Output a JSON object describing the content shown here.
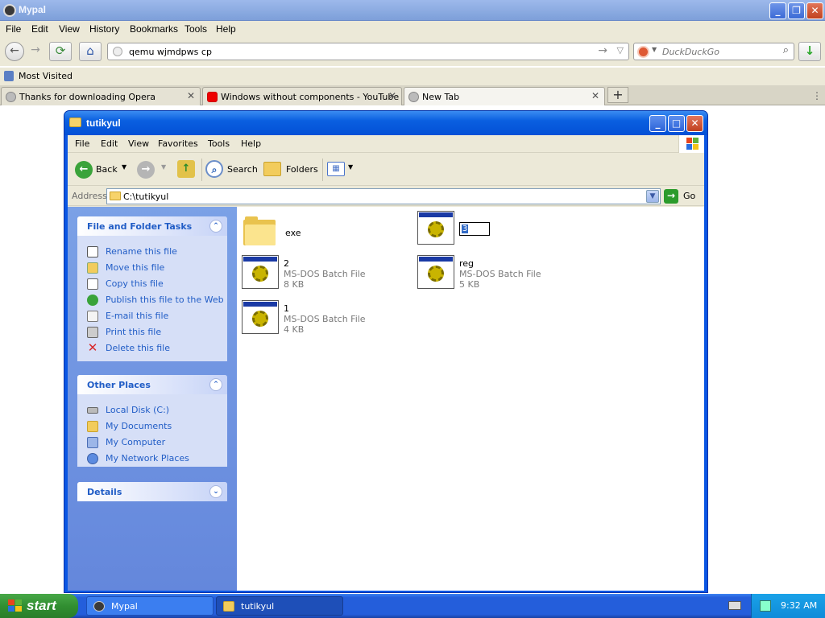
{
  "browser": {
    "title": "Mypal",
    "menu": [
      "File",
      "Edit",
      "View",
      "History",
      "Bookmarks",
      "Tools",
      "Help"
    ],
    "url": "qemu wjmdpws cp",
    "search_placeholder": "DuckDuckGo",
    "bookmark": "Most Visited",
    "tabs": [
      {
        "label": "Thanks for downloading Opera",
        "icon": "globe-icon"
      },
      {
        "label": "Windows without components - YouTube",
        "icon": "youtube-icon"
      },
      {
        "label": "New Tab",
        "icon": "globe-icon"
      }
    ],
    "new_tab_label": "+"
  },
  "explorer": {
    "title": "tutikyul",
    "menu": [
      "File",
      "Edit",
      "View",
      "Favorites",
      "Tools",
      "Help"
    ],
    "toolbar": {
      "back": "Back",
      "search": "Search",
      "folders": "Folders"
    },
    "address_label": "Address",
    "address": "C:\\tutikyul",
    "go_label": "Go",
    "tasks_panel": {
      "title": "File and Folder Tasks",
      "items": [
        "Rename this file",
        "Move this file",
        "Copy this file",
        "Publish this file to the Web",
        "E-mail this file",
        "Print this file",
        "Delete this file"
      ]
    },
    "places_panel": {
      "title": "Other Places",
      "items": [
        "Local Disk (C:)",
        "My Documents",
        "My Computer",
        "My Network Places"
      ]
    },
    "details_panel": {
      "title": "Details"
    },
    "files": [
      {
        "name": "exe",
        "kind": "folder"
      },
      {
        "name": "3",
        "kind": "batch",
        "renaming": true
      },
      {
        "name": "2",
        "type": "MS-DOS Batch File",
        "size": "8 KB"
      },
      {
        "name": "reg",
        "type": "MS-DOS Batch File",
        "size": "5 KB"
      },
      {
        "name": "1",
        "type": "MS-DOS Batch File",
        "size": "4 KB"
      }
    ]
  },
  "taskbar": {
    "start": "start",
    "tasks": [
      "Mypal",
      "tutikyul"
    ],
    "clock": "9:32 AM"
  },
  "colors": {
    "xp_blue": "#0a56e3",
    "sidebar_link": "#215dc6",
    "start_green": "#318f31"
  }
}
